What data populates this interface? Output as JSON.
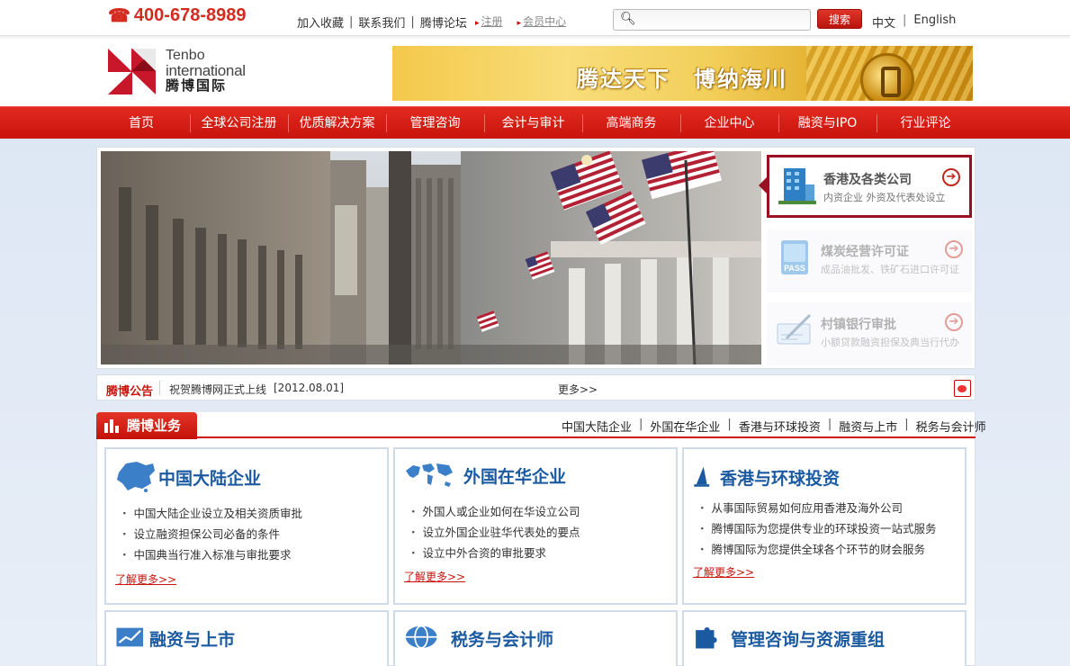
{
  "topbar": {
    "phone": "400-678-8989",
    "links": [
      "加入收藏",
      "联系我们",
      "腾博论坛"
    ],
    "register": "注册",
    "member_center": "会员中心",
    "search_placeholder": "",
    "search_button": "搜索",
    "lang_cn": "中文",
    "lang_en": "English"
  },
  "header": {
    "logo_en_1": "Tenbo",
    "logo_en_2": "international",
    "logo_cn": "腾博国际",
    "banner_text": "腾达天下　博纳海川",
    "logo_colors": {
      "red": "#c8172a",
      "dark": "#222222"
    }
  },
  "nav": {
    "items": [
      "首页",
      "全球公司注册",
      "优质解决方案",
      "管理咨询",
      "会计与审计",
      "高端商务",
      "企业中心",
      "融资与IPO",
      "行业评论"
    ]
  },
  "slider": {
    "items": [
      {
        "title": "香港及各类公司",
        "subtitle": "内资企业  外资及代表处设立",
        "icon": "building-icon",
        "active": true
      },
      {
        "title": "煤炭经营许可证",
        "subtitle": "成品油批发、铁矿石进口许可证",
        "icon": "pass-card-icon",
        "active": false
      },
      {
        "title": "村镇银行审批",
        "subtitle": "小额贷款融资担保及典当行代办",
        "icon": "cheque-pen-icon",
        "active": false
      }
    ]
  },
  "notice": {
    "title": "腾博公告",
    "text": "祝贺腾博网正式上线",
    "date": "[2012.08.01]",
    "more": "更多>>"
  },
  "business": {
    "tab_title": "腾博业务",
    "links": [
      "中国大陆企业",
      "外国在华企业",
      "香港与环球投资",
      "融资与上市",
      "税务与会计师"
    ],
    "cards": [
      {
        "title": "中国大陆企业",
        "icon": "china-map-icon",
        "items": [
          "中国大陆企业设立及相关资质审批",
          "设立融资担保公司必备的条件",
          "中国典当行准入标准与审批要求"
        ],
        "more": "了解更多>>"
      },
      {
        "title": "外国在华企业",
        "icon": "world-map-icon",
        "items": [
          "外国人或企业如何在华设立公司",
          "设立外国企业驻华代表处的要点",
          "设立中外合资的审批要求"
        ],
        "more": "了解更多>>"
      },
      {
        "title": "香港与环球投资",
        "icon": "sail-icon",
        "items": [
          "从事国际贸易如何应用香港及海外公司",
          "腾博国际为您提供专业的环球投资一站式服务",
          "腾博国际为您提供全球各个环节的财会服务"
        ],
        "more": "了解更多>>"
      },
      {
        "title": "融资与上市",
        "icon": "chart-up-icon"
      },
      {
        "title": "税务与会计师",
        "icon": "globe-icon"
      },
      {
        "title": "管理咨询与资源重组",
        "icon": "puzzle-icon"
      }
    ]
  },
  "colors": {
    "brand_red": "#c8140c",
    "card_title_blue": "#1b5aa0"
  }
}
